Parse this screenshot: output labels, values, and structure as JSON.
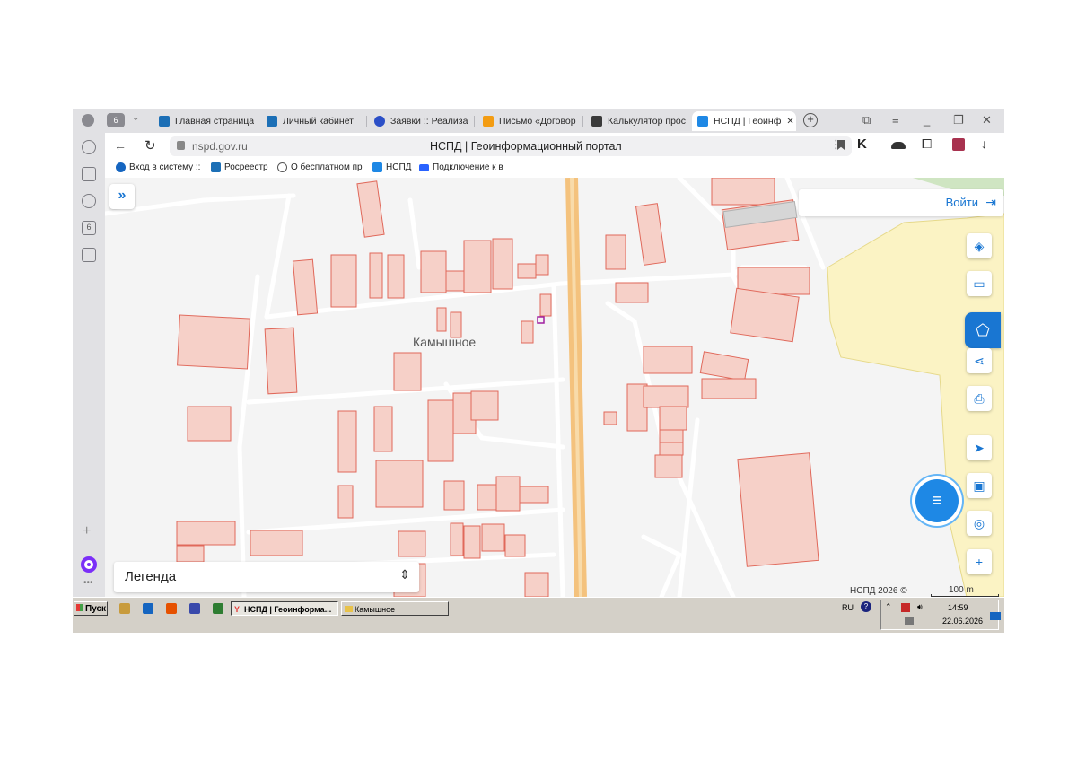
{
  "browser": {
    "tab_count_badge": "6",
    "tabs": [
      {
        "label": "Главная страница",
        "icon_color": "#1c6fb6"
      },
      {
        "label": "Личный кабинет",
        "icon_color": "#1c6fb6"
      },
      {
        "label": "Заявки :: Реализа",
        "icon_color": "#2b4fc7"
      },
      {
        "label": "Письмо «Договор",
        "icon_color": "#f39c12"
      },
      {
        "label": "Калькулятор прос",
        "icon_color": "#3a3a3a"
      },
      {
        "label": "НСПД | Геоинф",
        "icon_color": "#1e88e5"
      }
    ],
    "url": "nspd.gov.ru",
    "page_title": "НСПД | Геоинформационный портал",
    "bookmarks": [
      {
        "label": "Вход в систему ::",
        "icon_color": "#1565c0"
      },
      {
        "label": "Росреестр",
        "icon_color": "#1c6fb6"
      },
      {
        "label": "О бесплатном пр",
        "icon_color": "#555555"
      },
      {
        "label": "НСПД",
        "icon_color": "#1e88e5"
      },
      {
        "label": "Подключение к в",
        "icon_color": "#2962ff"
      }
    ],
    "sidebar_badge": "6"
  },
  "map": {
    "place_label": "Камышное",
    "login_label": "Войти",
    "legend_label": "Легенда",
    "copyright": "НСПД 2026 ©",
    "scale_label": "100 m",
    "colors": {
      "parcel_fill": "#f6d0c8",
      "parcel_stroke": "#e0685a",
      "road": "#ffffff",
      "highway": "#f4c27d",
      "zone_fill": "#fbf3c4",
      "accent": "#1976d2"
    }
  },
  "taskbar": {
    "start_label": "Пуск",
    "windows": [
      {
        "label": "НСПД | Геоинформа...",
        "active": true
      },
      {
        "label": "Камышное",
        "active": false
      }
    ],
    "lang": "RU",
    "time": "14:59",
    "date": "22.06.2026"
  }
}
